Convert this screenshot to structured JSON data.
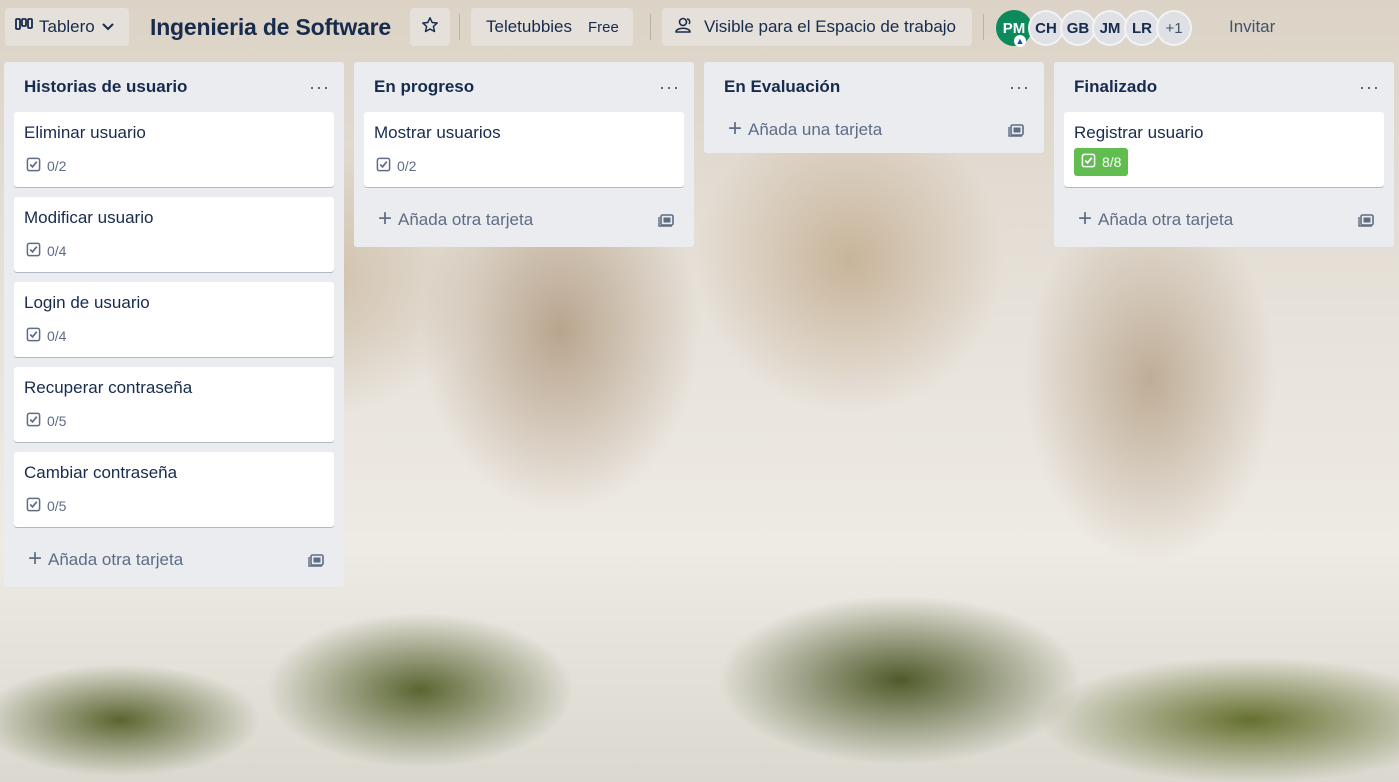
{
  "header": {
    "view_label": "Tablero",
    "board_title": "Ingenieria de Software",
    "workspace_name": "Teletubbies",
    "workspace_plan": "Free",
    "visibility_label": "Visible para el Espacio de trabajo",
    "members": [
      "PM",
      "CH",
      "GB",
      "JM",
      "LR"
    ],
    "members_more": "+1",
    "invite_label": "Invitar"
  },
  "lists": [
    {
      "title": "Historias de usuario",
      "menu": "···",
      "cards": [
        {
          "title": "Eliminar usuario",
          "checklist": "0/2"
        },
        {
          "title": "Modificar usuario",
          "checklist": "0/4"
        },
        {
          "title": "Login de usuario",
          "checklist": "0/4"
        },
        {
          "title": "Recuperar contraseña",
          "checklist": "0/5"
        },
        {
          "title": "Cambiar contraseña",
          "checklist": "0/5"
        }
      ],
      "add_label": "Añada otra tarjeta"
    },
    {
      "title": "En progreso",
      "menu": "···",
      "cards": [
        {
          "title": "Mostrar usuarios",
          "checklist": "0/2"
        }
      ],
      "add_label": "Añada otra tarjeta"
    },
    {
      "title": "En Evaluación",
      "menu": "···",
      "cards": [],
      "add_label": "Añada una tarjeta"
    },
    {
      "title": "Finalizado",
      "menu": "···",
      "cards": [
        {
          "title": "Registrar usuario",
          "checklist": "8/8",
          "complete": true
        }
      ],
      "add_label": "Añada otra tarjeta"
    }
  ],
  "colors": {
    "list_bg": "#ebecf0",
    "text": "#172b4d",
    "checklist_complete": "#61bd4f",
    "admin_avatar": "#0d8a5c"
  }
}
